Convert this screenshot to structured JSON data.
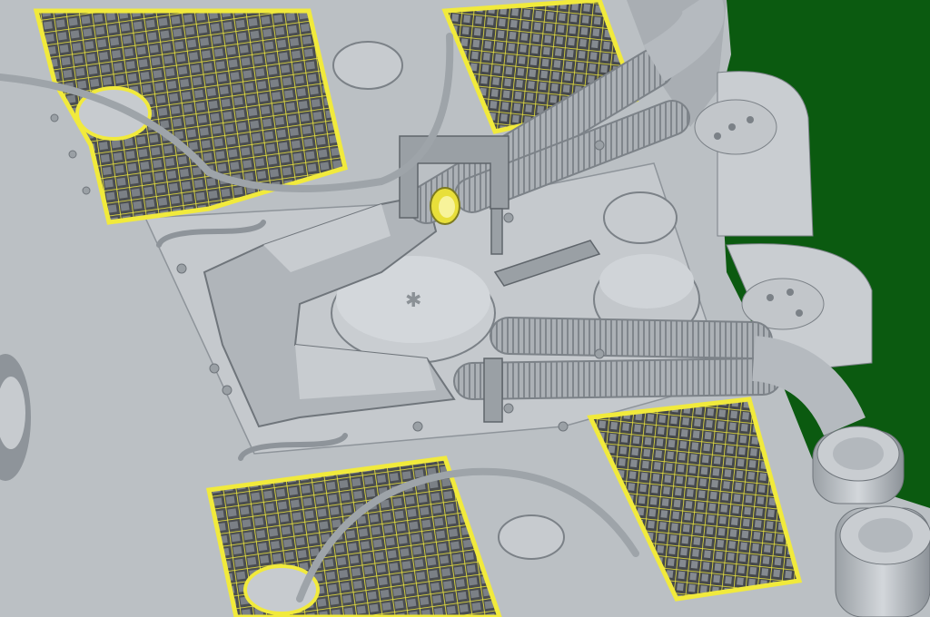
{
  "scene": {
    "subject": "engine-deck-3d-render",
    "colors": {
      "background": "#0b5a10",
      "hull": "#b9bec3",
      "hull_light": "#cdd2d6",
      "hull_dark": "#8e949a",
      "edge": "#6f757b",
      "mesh": "#f1ea3c",
      "mesh_shadow": "#3b3d3f",
      "hose": "#a7adb2",
      "hose_rib": "#7c8288",
      "brass": "#e8df3a"
    },
    "components": [
      "grille-top-left",
      "grille-top-right",
      "grille-bottom-left",
      "grille-bottom-right",
      "air-intake-housing",
      "fan-cover",
      "corrugated-hoses",
      "exhaust-cylinders",
      "cables",
      "handles"
    ]
  }
}
